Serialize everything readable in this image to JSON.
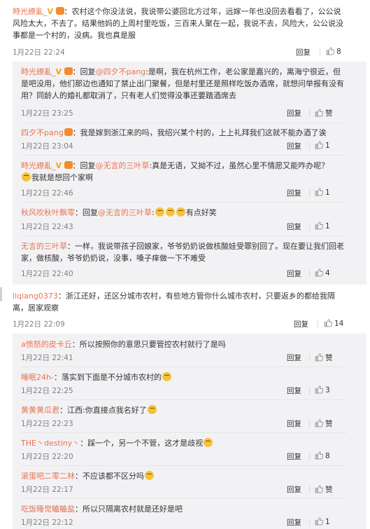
{
  "comments": [
    {
      "user": "時光繚亂_",
      "text": "：农村这个你没法说，我说带公婆回北方过年，远嫁一年也没回去看看了，公公说风险太大，不去了。结果他妈的上周村里吃饭，三百来人聚在一起，我说不去，风险大，公公说没事都是一个村的，没病。我也真是服",
      "time": "1月22日 22:24",
      "reply": "回复",
      "likes": "8"
    }
  ],
  "thread1": [
    {
      "user": "時光繚亂_",
      "prefix": "：回复",
      "mention": "@四夕不pang",
      "text": ":是啊，我在杭州工作，老公家是嘉兴的，离海宁很近，但是吧没用，他们那边也通知了禁止出门聚餐，但是村里还是照样吃饭办酒席，就想问举报有没有用？同龄人的婚礼都取消了，只有老人们觉得没事还要踏酒席去",
      "time": "1月22日 23:25",
      "reply": "回复",
      "likes": "赞"
    },
    {
      "user": "四夕不pang",
      "prefix": "：我是嫁到浙江来的吗，我绍兴某个村的，上上礼拜我们这就不能办酒了诶",
      "mention": "",
      "text": "",
      "time": "1月22日 23:04",
      "reply": "回复",
      "likes": "1"
    },
    {
      "user": "時光繚亂_",
      "prefix": "：回复",
      "mention": "@无言的三叶草",
      "text": ":真是无语，又拗不过，虽然心里不情愿又能咋办呢？",
      "text2": "我就是想回个家啊",
      "time": "1月22日 22:46",
      "reply": "回复",
      "likes": "1"
    },
    {
      "user": "秋风吹秋叶飘零",
      "prefix": "：回复",
      "mention": "@无言的三叶草",
      "text": ":",
      "text2": "有点好笑",
      "time": "1月22日 22:43",
      "reply": "回复",
      "likes": "1"
    },
    {
      "user": "无言的三叶草",
      "prefix": "：一样，我说带孩子回娘家，爷爷奶奶说做核酸娃受罪别回了。现在要让我们回老家，做核酸，爷爷奶奶说，没事，嗓子痒做一下不难受",
      "mention": "",
      "text": "",
      "time": "1月22日 22:40",
      "reply": "回复",
      "likes": "4"
    }
  ],
  "comment2": {
    "user": "liqiang0373",
    "text": "：浙江还好，还区分城市农村，有些地方管你什么城市农村，只要返乡的都给我隔离，居家观察",
    "time": "1月22日 22:09",
    "reply": "回复",
    "likes": "14"
  },
  "thread2": [
    {
      "user": "a愤怒的皮卡丘",
      "text": "：所以按照你的意思只要管控农村就行了是吗",
      "time": "1月22日 22:41",
      "reply": "回复",
      "likes": "赞"
    },
    {
      "user": "睡眠24h-",
      "text": "：落实到下面是不分城市农村的",
      "time": "1月22日 22:25",
      "reply": "回复",
      "likes": "3"
    },
    {
      "user": "黄黄黄瓜君",
      "text": "：江西:你直接点我名好了",
      "time": "1月22日 22:23",
      "reply": "回复",
      "likes": "赞"
    },
    {
      "user": "THE丶destiny丶",
      "text": "：踩一个，另一个不管，这才是歧视",
      "time": "1月22日 22:20",
      "reply": "回复",
      "likes": "8"
    },
    {
      "user": "滚蛋吧二零二林",
      "text": "：不应该都不区分吗",
      "time": "1月22日 22:17",
      "reply": "回复",
      "likes": "赞"
    },
    {
      "user": "吃饭睡觉瞌瞌盐",
      "text": "：所以只隔离农村就是还好是吧",
      "time": "1月22日 22:12",
      "reply": "回复",
      "likes": "1"
    }
  ]
}
